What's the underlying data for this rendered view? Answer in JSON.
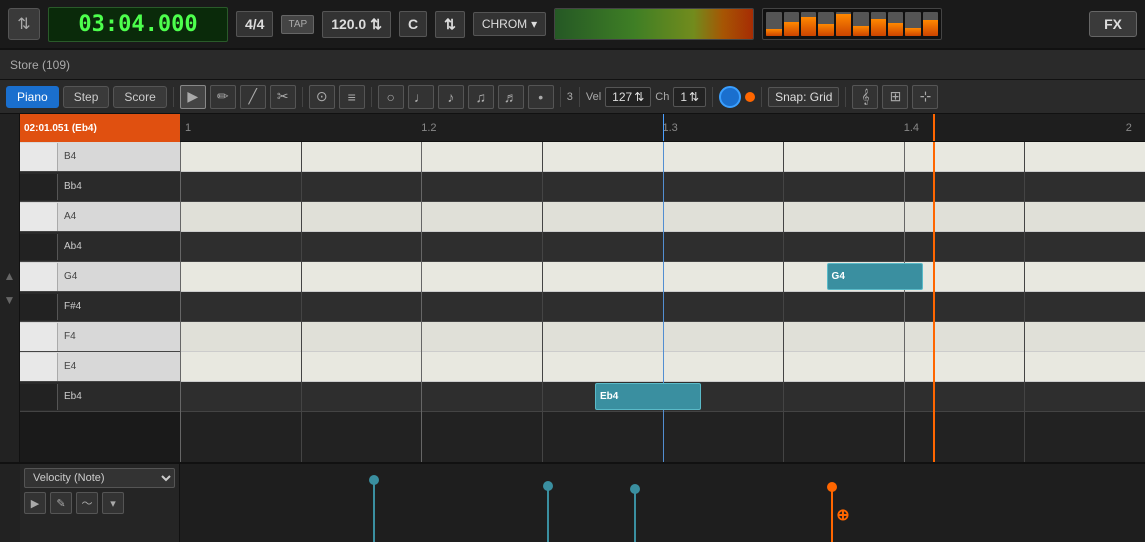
{
  "transport": {
    "time": "03:04.000",
    "time_sig": "4/4",
    "tap_label": "TAP",
    "tempo": "120.0",
    "key": "C",
    "scale": "CHROM",
    "fx_label": "FX"
  },
  "store": {
    "label": "Store (109)"
  },
  "toolbar": {
    "tabs": [
      "Piano",
      "Step",
      "Score"
    ],
    "active_tab": "Piano",
    "vel_label": "Vel",
    "vel_value": "127",
    "ch_label": "Ch",
    "ch_value": "1",
    "snap_label": "Snap: Grid",
    "note_count": "3"
  },
  "piano_keys": [
    {
      "name": "B4",
      "type": "white"
    },
    {
      "name": "Bb4",
      "type": "black"
    },
    {
      "name": "A4",
      "type": "white"
    },
    {
      "name": "Ab4",
      "type": "black"
    },
    {
      "name": "G4",
      "type": "white"
    },
    {
      "name": "F#4",
      "type": "black"
    },
    {
      "name": "F4",
      "type": "white"
    },
    {
      "name": "E4",
      "type": "white"
    },
    {
      "name": "Eb4",
      "type": "black"
    }
  ],
  "ruler": {
    "labels": [
      "1",
      "1.2",
      "1.3",
      "1.4",
      "2"
    ],
    "positions": [
      0,
      25,
      50,
      75,
      100
    ]
  },
  "notes": [
    {
      "id": "eb4",
      "label": "Eb4",
      "row": 8,
      "left_pct": 43,
      "width_pct": 10
    },
    {
      "id": "g4",
      "label": "G4",
      "row": 4,
      "left_pct": 67,
      "width_pct": 10
    }
  ],
  "playhead": {
    "position_pct": 78
  },
  "position_label": "02:01.051 (Eb4)",
  "velocity": {
    "label": "Velocity (Note)",
    "markers": [
      {
        "left_pct": 20,
        "height_pct": 85,
        "type": "blue"
      },
      {
        "left_pct": 38,
        "height_pct": 75,
        "type": "blue"
      },
      {
        "left_pct": 47,
        "height_pct": 70,
        "type": "blue"
      },
      {
        "left_pct": 67,
        "height_pct": 72,
        "type": "orange"
      }
    ]
  },
  "icons": {
    "arrows": "⇅",
    "play": "▶",
    "pencil": "✎",
    "eraser": "⌫",
    "select": "⊹",
    "note_quarter": "♩",
    "note_eighth": "♪",
    "note_sixteenth": "♬",
    "dot": "•",
    "circle": "○",
    "lines": "≡",
    "grid_icon": "⊞",
    "snap_icon": "𝄞",
    "expand": "⊞",
    "chevron_down": "▾",
    "chevron_left": "◀",
    "chevron_right": "▶"
  },
  "eq_bars": [
    30,
    60,
    80,
    50,
    90,
    40,
    70,
    55,
    35,
    65
  ]
}
